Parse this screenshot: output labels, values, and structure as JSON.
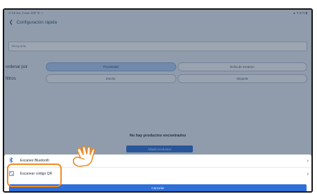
{
  "status_bar": {
    "left": "17:18 Jue, 2 mar. 3/DF ⊕ ◦ •",
    "right": "▲ ✦ 87% ▮"
  },
  "header": {
    "back_icon": "arrow-left-icon",
    "title": "Configuración rápida"
  },
  "search": {
    "placeholder": "Búsqueda"
  },
  "sort": {
    "label": "ordenar por",
    "options": [
      {
        "label": "Proximidad",
        "selected": true
      },
      {
        "label": "fecha de escaneo",
        "selected": false
      }
    ]
  },
  "filters": {
    "label": "filtros",
    "options": [
      {
        "label": "Escrito",
        "selected": false
      },
      {
        "label": "Etiqueta",
        "selected": false
      }
    ]
  },
  "empty_state": {
    "message": "No hay productos encontrados",
    "add_button": "Añadir productos"
  },
  "bottom_sheet": {
    "items": [
      {
        "icon": "bluetooth-icon",
        "label": "Escaneo Bluetooth"
      },
      {
        "icon": "qr-code-icon",
        "label": "Escanear código QR"
      }
    ],
    "cancel_label": "Cancelar"
  },
  "colors": {
    "accent": "#2e6fd8",
    "highlight": "#ef8a24",
    "selected_segment": "#a9c6ef"
  }
}
